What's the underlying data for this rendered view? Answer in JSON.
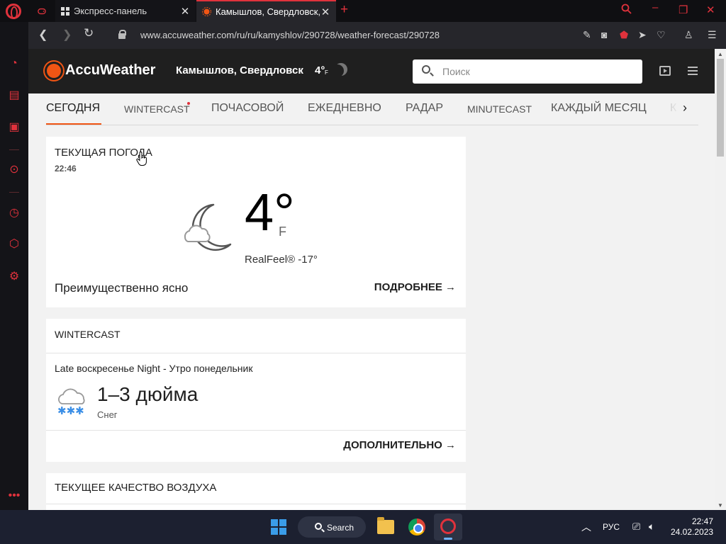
{
  "browser": {
    "tabs": [
      {
        "label": "Экспресс-панель"
      },
      {
        "label": "Камышлов, Свердловск, Р"
      }
    ],
    "url": "www.accuweather.com/ru/ru/kamyshlov/290728/weather-forecast/290728"
  },
  "site": {
    "logo": "AccuWeather",
    "location": "Камышлов, Свердловск",
    "location_temp": "4°",
    "location_unit": "F",
    "search_placeholder": "Поиск"
  },
  "subnav": {
    "items": [
      "СЕГОДНЯ",
      "WINTERCAST",
      "ПОЧАСОВОЙ",
      "ЕЖЕДНЕВНО",
      "РАДАР",
      "MINUTECAST",
      "КАЖДЫЙ МЕСЯЦ",
      "К"
    ],
    "active_index": 0
  },
  "current_weather": {
    "title": "ТЕКУЩАЯ ПОГОДА",
    "time": "22:46",
    "temp": "4°",
    "unit": "F",
    "realfeel": "RealFeel® -17°",
    "condition": "Преимущественно ясно",
    "more_label": "ПОДРОБНЕЕ →"
  },
  "wintercast": {
    "title": "WINTERCAST",
    "period": "Late воскресенье Night - Утро понедельник",
    "amount": "1–3 дюйма",
    "type": "Снег",
    "more_label": "ДОПОЛНИТЕЛЬНО →"
  },
  "air_quality": {
    "title": "ТЕКУЩЕЕ КАЧЕСТВО ВОЗДУХА"
  },
  "taskbar": {
    "search_label": "Search",
    "language": "РУС",
    "time": "22:47",
    "date": "24.02.2023"
  },
  "colors": {
    "opera_red": "#e0323c",
    "accuweather_orange": "#f05514",
    "header_dark": "#1f1f1f"
  }
}
